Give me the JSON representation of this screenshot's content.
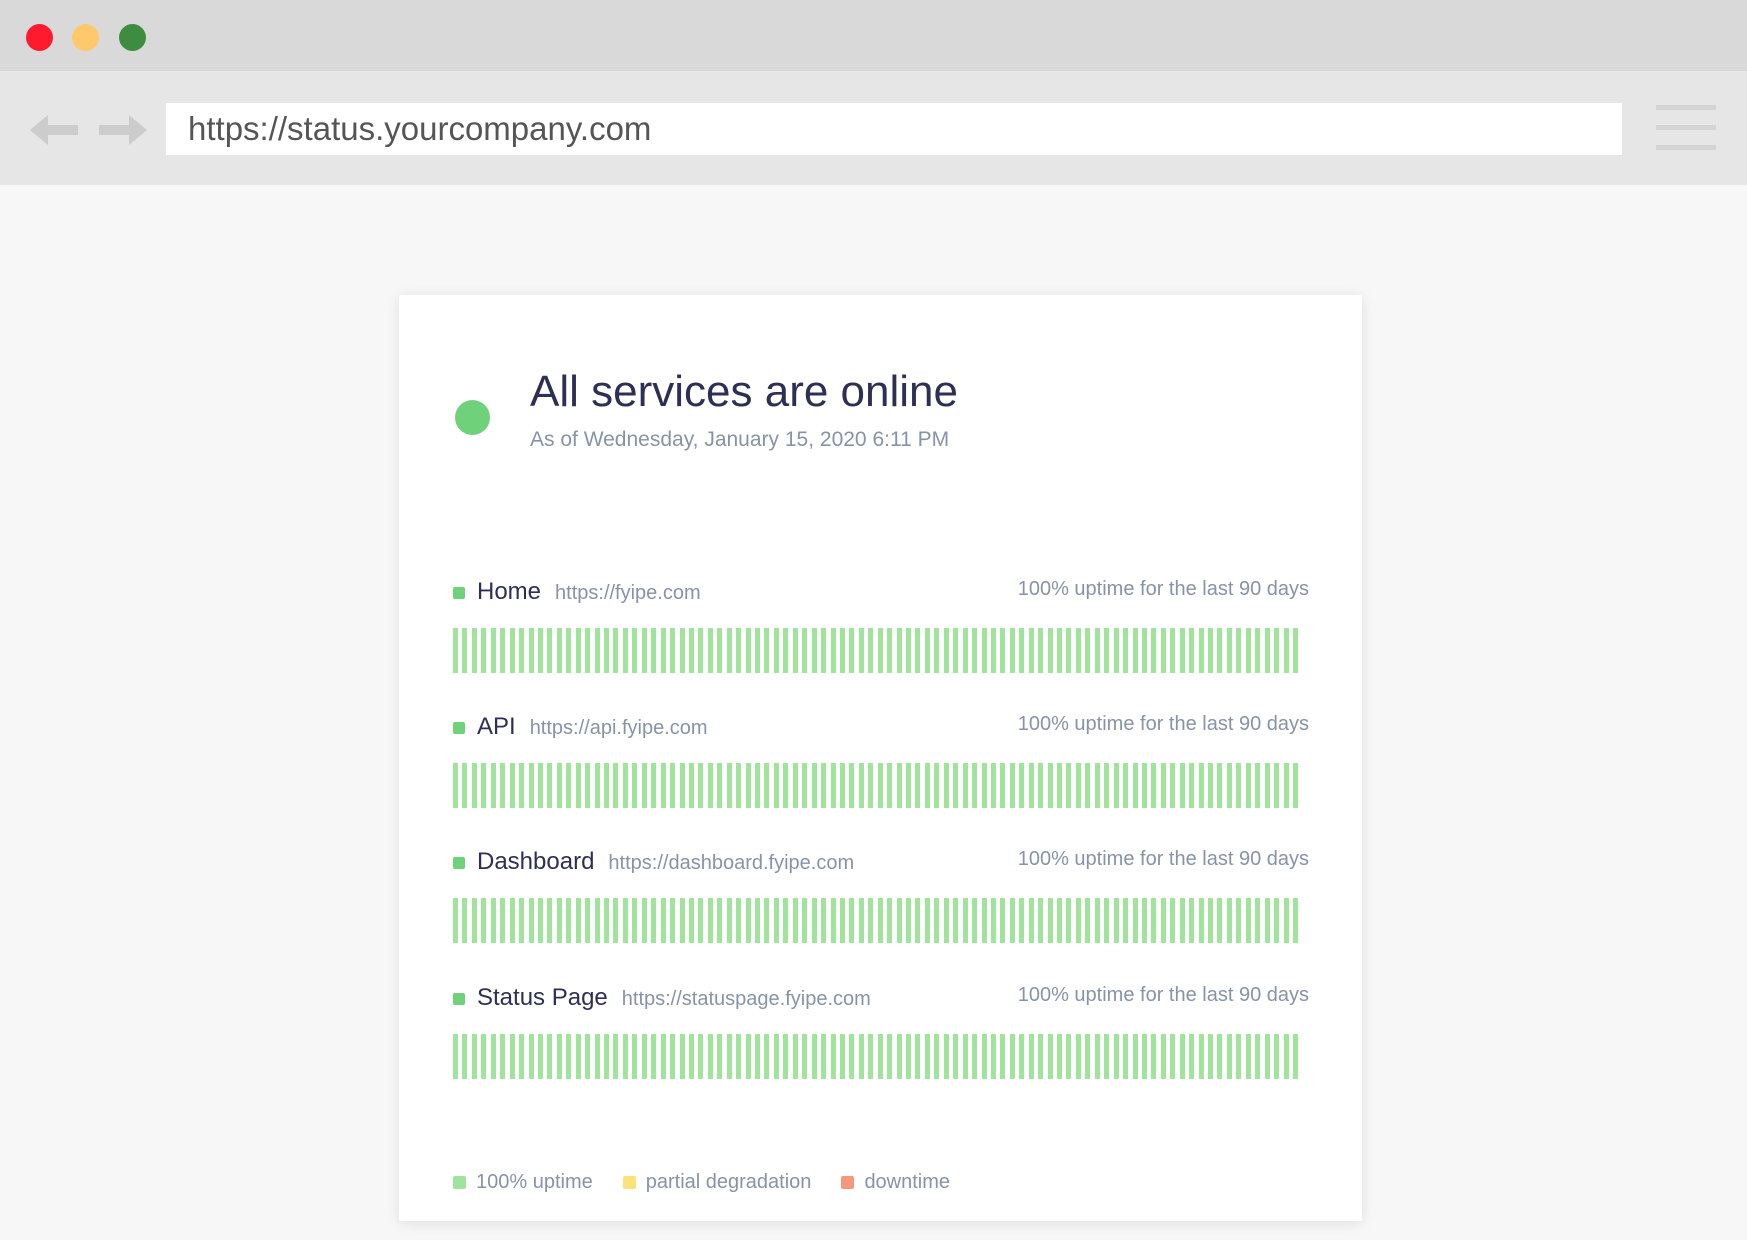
{
  "browser": {
    "url": "https://status.yourcompany.com",
    "window_controls": [
      {
        "name": "close",
        "color": "#ff1a2e"
      },
      {
        "name": "minimize",
        "color": "#ffc86b"
      },
      {
        "name": "zoom",
        "color": "#3d8c40"
      }
    ],
    "icons": {
      "back": "arrow-left-icon",
      "forward": "arrow-right-icon",
      "menu": "hamburger-menu-icon"
    }
  },
  "status": {
    "headline": "All services are online",
    "as_of": "As of Wednesday, January 15, 2020 6:11 PM",
    "indicator_color": "#6fd17a"
  },
  "services": [
    {
      "name": "Home",
      "url": "https://fyipe.com",
      "uptime_text": "100% uptime for the last 90 days",
      "uptime_percent": 100,
      "days": 90
    },
    {
      "name": "API",
      "url": "https://api.fyipe.com",
      "uptime_text": "100% uptime for the last 90 days",
      "uptime_percent": 100,
      "days": 90
    },
    {
      "name": "Dashboard",
      "url": "https://dashboard.fyipe.com",
      "uptime_text": "100% uptime for the last 90 days",
      "uptime_percent": 100,
      "days": 90
    },
    {
      "name": "Status Page",
      "url": "https://statuspage.fyipe.com",
      "uptime_text": "100% uptime for the last 90 days",
      "uptime_percent": 100,
      "days": 90
    }
  ],
  "legend": [
    {
      "label": "100% uptime",
      "color": "#9fe49a"
    },
    {
      "label": "partial degradation",
      "color": "#fde17a"
    },
    {
      "label": "downtime",
      "color": "#f6987e"
    }
  ],
  "colors": {
    "service_dot": "#6fd17a",
    "bar_up": "#9fe49a"
  }
}
